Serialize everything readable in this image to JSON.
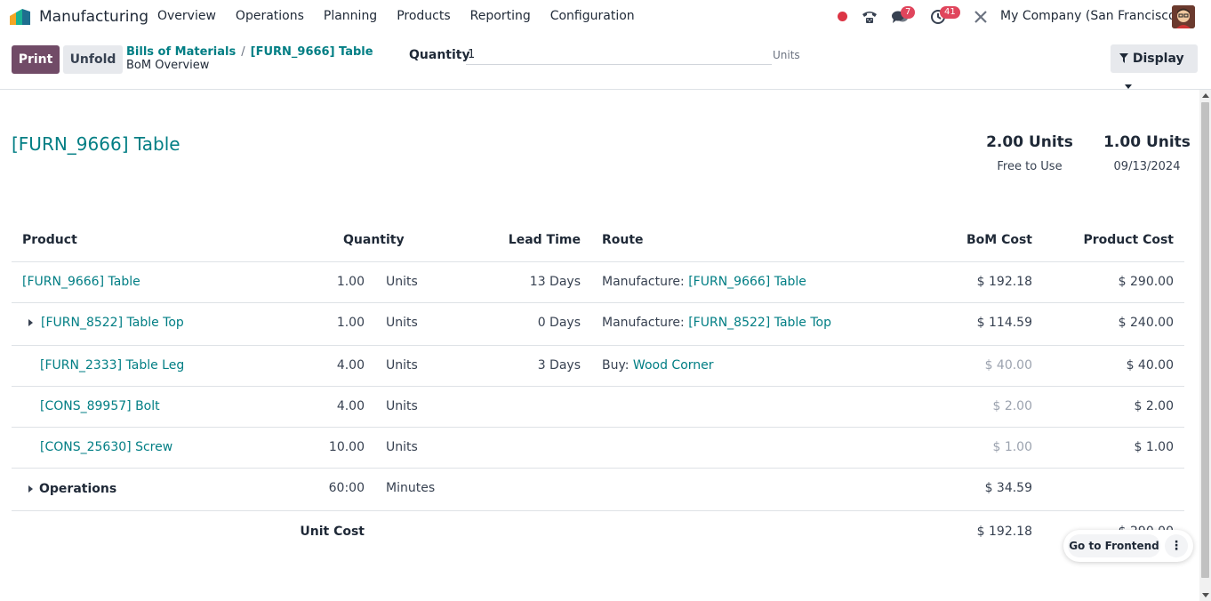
{
  "nav": {
    "app_name": "Manufacturing",
    "menu": [
      "Overview",
      "Operations",
      "Planning",
      "Products",
      "Reporting",
      "Configuration"
    ],
    "messages_count": "7",
    "activities_count": "41",
    "company": "My Company (San Francisco)"
  },
  "control": {
    "print_label": "Print",
    "unfold_label": "Unfold",
    "breadcrumb": [
      "Bills of Materials",
      "[FURN_9666] Table"
    ],
    "breadcrumb_current": "BoM Overview",
    "quantity_label": "Quantity",
    "quantity_value": "1",
    "quantity_unit": "Units",
    "display_label": "Display"
  },
  "report": {
    "title": "[FURN_9666] Table",
    "stats": [
      {
        "value": "2.00 Units",
        "label": "Free to Use"
      },
      {
        "value": "1.00 Units",
        "label": "09/13/2024"
      }
    ],
    "headers": {
      "product": "Product",
      "quantity": "Quantity",
      "lead_time": "Lead Time",
      "route": "Route",
      "bom_cost": "BoM Cost",
      "product_cost": "Product Cost"
    },
    "rows": [
      {
        "product": "[FURN_9666] Table",
        "qty": "1.00",
        "uom": "Units",
        "lead": "13 Days",
        "route_prefix": "Manufacture: ",
        "route_link": "[FURN_9666] Table",
        "bom_cost": "$ 192.18",
        "product_cost": "$ 290.00"
      },
      {
        "product": "[FURN_8522] Table Top",
        "qty": "1.00",
        "uom": "Units",
        "lead": "0 Days",
        "route_prefix": "Manufacture: ",
        "route_link": "[FURN_8522] Table Top",
        "bom_cost": "$ 114.59",
        "product_cost": "$ 240.00"
      },
      {
        "product": "[FURN_2333] Table Leg",
        "qty": "4.00",
        "uom": "Units",
        "lead": "3 Days",
        "route_prefix": "Buy: ",
        "route_link": "Wood Corner",
        "bom_cost": "$ 40.00",
        "product_cost": "$ 40.00"
      },
      {
        "product": "[CONS_89957] Bolt",
        "qty": "4.00",
        "uom": "Units",
        "lead": "",
        "route_prefix": "",
        "route_link": "",
        "bom_cost": "$ 2.00",
        "product_cost": "$ 2.00"
      },
      {
        "product": "[CONS_25630] Screw",
        "qty": "10.00",
        "uom": "Units",
        "lead": "",
        "route_prefix": "",
        "route_link": "",
        "bom_cost": "$ 1.00",
        "product_cost": "$ 1.00"
      }
    ],
    "operations": {
      "label": "Operations",
      "qty": "60:00",
      "uom": "Minutes",
      "bom_cost": "$ 34.59"
    },
    "unit_cost": {
      "label": "Unit Cost",
      "bom_cost": "$ 192.18",
      "product_cost": "$ 290.00"
    }
  },
  "frontend": {
    "button_label": "Go to Frontend",
    "more_label": "⋮"
  }
}
